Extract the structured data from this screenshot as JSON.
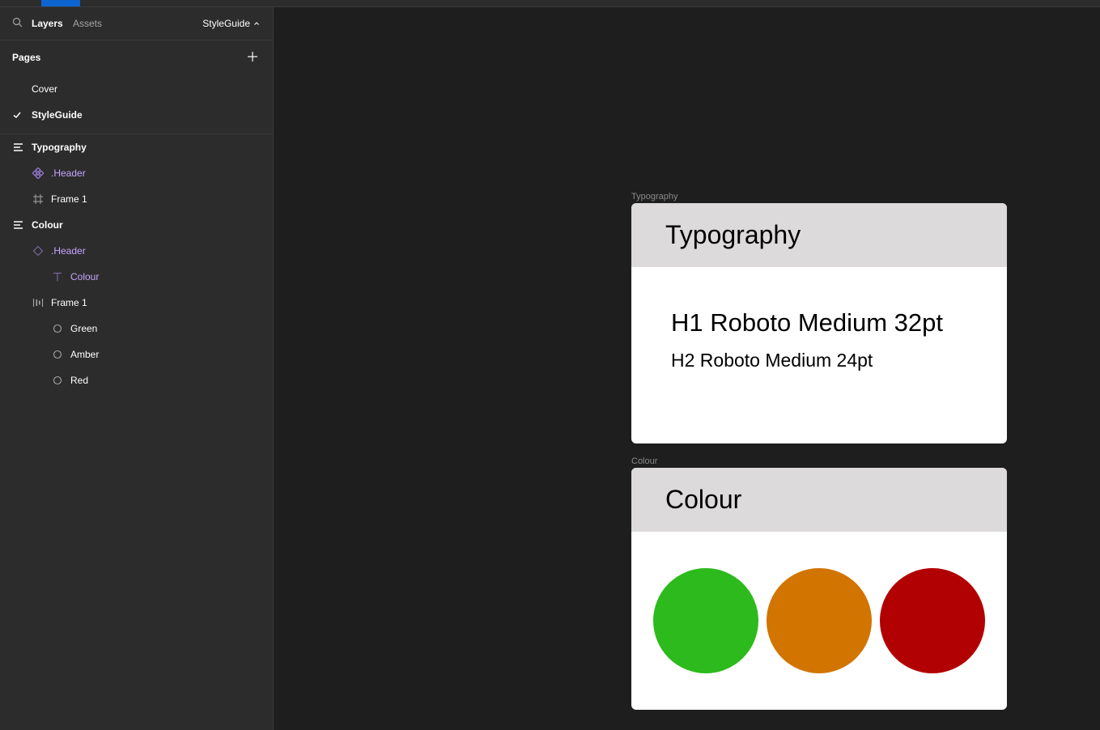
{
  "sidebar": {
    "tabs": {
      "layers": "Layers",
      "assets": "Assets"
    },
    "current_page": "StyleGuide",
    "pages_title": "Pages",
    "pages": [
      {
        "label": "Cover",
        "selected": false
      },
      {
        "label": "StyleGuide",
        "selected": true
      }
    ],
    "layers": [
      {
        "label": "Typography",
        "icon": "section-icon",
        "indent": 0,
        "bold": true,
        "purple": false
      },
      {
        "label": ".Header",
        "icon": "component-instance-icon",
        "indent": 1,
        "bold": false,
        "purple": true
      },
      {
        "label": "Frame 1",
        "icon": "frame-hash-icon",
        "indent": 1,
        "bold": false,
        "purple": false
      },
      {
        "label": "Colour",
        "icon": "section-icon",
        "indent": 0,
        "bold": true,
        "purple": false
      },
      {
        "label": ".Header",
        "icon": "diamond-icon",
        "indent": 1,
        "bold": false,
        "purple": true
      },
      {
        "label": "Colour",
        "icon": "text-icon",
        "indent": 2,
        "bold": false,
        "purple": true
      },
      {
        "label": "Frame 1",
        "icon": "auto-layout-icon",
        "indent": 1,
        "bold": false,
        "purple": false
      },
      {
        "label": "Green",
        "icon": "ellipse-icon",
        "indent": 2,
        "bold": false,
        "purple": false
      },
      {
        "label": "Amber",
        "icon": "ellipse-icon",
        "indent": 2,
        "bold": false,
        "purple": false
      },
      {
        "label": "Red",
        "icon": "ellipse-icon",
        "indent": 2,
        "bold": false,
        "purple": false
      }
    ]
  },
  "canvas": {
    "typography_frame": {
      "label": "Typography",
      "title": "Typography",
      "h1_sample": "H1 Roboto Medium 32pt",
      "h2_sample": "H2 Roboto Medium 24pt"
    },
    "colour_frame": {
      "label": "Colour",
      "title": "Colour",
      "swatches": [
        {
          "name": "Green",
          "color": "#2dba1c"
        },
        {
          "name": "Amber",
          "color": "#d27400"
        },
        {
          "name": "Red",
          "color": "#b20103"
        }
      ]
    }
  },
  "colors": {
    "accent": "#0d66d0",
    "component_purple": "#c7a5ff"
  }
}
